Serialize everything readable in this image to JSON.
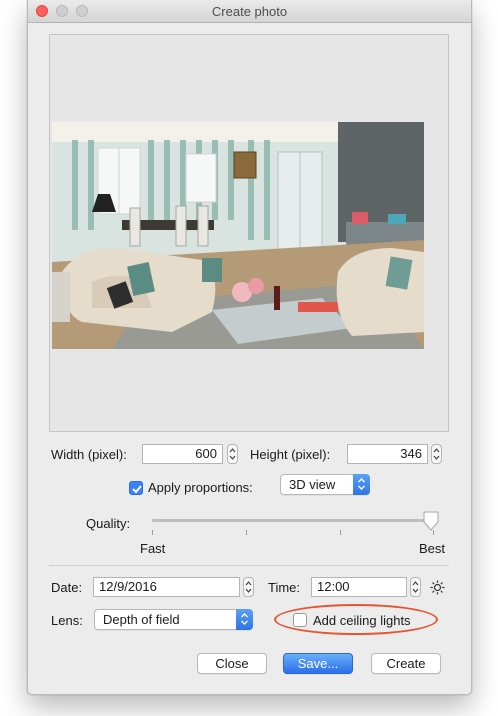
{
  "window": {
    "title": "Create photo"
  },
  "size": {
    "width_label": "Width (pixel):",
    "width_value": "600",
    "height_label": "Height (pixel):",
    "height_value": "346"
  },
  "proportions": {
    "label": "Apply proportions:",
    "checked": true,
    "view_selected": "3D view"
  },
  "quality": {
    "label": "Quality:",
    "fast_label": "Fast",
    "best_label": "Best",
    "level": 1.0
  },
  "date": {
    "label": "Date:",
    "value": "12/9/2016"
  },
  "time": {
    "label": "Time:",
    "value": "12:00"
  },
  "lens": {
    "label": "Lens:",
    "selected": "Depth of field"
  },
  "ceiling_lights": {
    "label": "Add ceiling lights",
    "checked": false
  },
  "buttons": {
    "close": "Close",
    "save": "Save...",
    "create": "Create"
  },
  "colors": {
    "accent": "#3b82f6",
    "highlight_ring": "#e8542f"
  }
}
